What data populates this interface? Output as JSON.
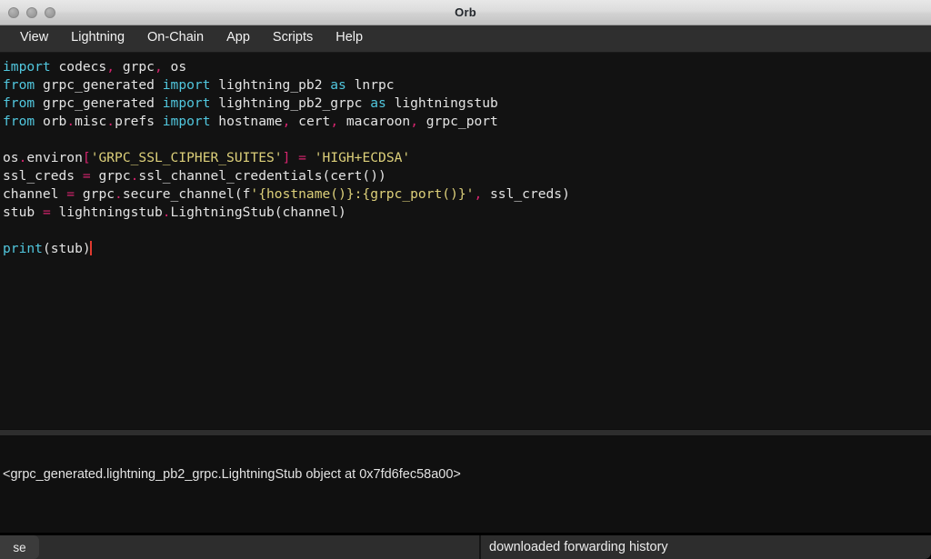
{
  "window": {
    "title": "Orb",
    "traffic_lights": [
      "close",
      "minimize",
      "zoom"
    ]
  },
  "menubar": {
    "items": [
      {
        "label": "View"
      },
      {
        "label": "Lightning"
      },
      {
        "label": "On-Chain"
      },
      {
        "label": "App"
      },
      {
        "label": "Scripts"
      },
      {
        "label": "Help"
      }
    ]
  },
  "editor": {
    "language": "python",
    "caret_visible": true,
    "code_text": "import codecs, grpc, os\nfrom grpc_generated import lightning_pb2 as lnrpc\nfrom grpc_generated import lightning_pb2_grpc as lightningstub\nfrom orb.misc.prefs import hostname, cert, macaroon, grpc_port\n\nos.environ['GRPC_SSL_CIPHER_SUITES'] = 'HIGH+ECDSA'\nssl_creds = grpc.ssl_channel_credentials(cert())\nchannel = grpc.secure_channel(f'{hostname()}:{grpc_port()}', ssl_creds)\nstub = lightningstub.LightningStub(channel)\n\nprint(stub)",
    "lines": [
      {
        "n": 1,
        "tokens": [
          {
            "t": "import",
            "c": "kw"
          },
          {
            "t": " codecs",
            "c": "id"
          },
          {
            "t": ",",
            "c": "punc"
          },
          {
            "t": " grpc",
            "c": "id"
          },
          {
            "t": ",",
            "c": "punc"
          },
          {
            "t": " os",
            "c": "id"
          }
        ]
      },
      {
        "n": 2,
        "tokens": [
          {
            "t": "from",
            "c": "kw"
          },
          {
            "t": " grpc_generated ",
            "c": "id"
          },
          {
            "t": "import",
            "c": "kw"
          },
          {
            "t": " lightning_pb2 ",
            "c": "id"
          },
          {
            "t": "as",
            "c": "kw"
          },
          {
            "t": " lnrpc",
            "c": "id"
          }
        ]
      },
      {
        "n": 3,
        "tokens": [
          {
            "t": "from",
            "c": "kw"
          },
          {
            "t": " grpc_generated ",
            "c": "id"
          },
          {
            "t": "import",
            "c": "kw"
          },
          {
            "t": " lightning_pb2_grpc ",
            "c": "id"
          },
          {
            "t": "as",
            "c": "kw"
          },
          {
            "t": " lightningstub",
            "c": "id"
          }
        ]
      },
      {
        "n": 4,
        "tokens": [
          {
            "t": "from",
            "c": "kw"
          },
          {
            "t": " orb",
            "c": "id"
          },
          {
            "t": ".",
            "c": "punc"
          },
          {
            "t": "misc",
            "c": "id"
          },
          {
            "t": ".",
            "c": "punc"
          },
          {
            "t": "prefs ",
            "c": "id"
          },
          {
            "t": "import",
            "c": "kw"
          },
          {
            "t": " hostname",
            "c": "id"
          },
          {
            "t": ",",
            "c": "punc"
          },
          {
            "t": " cert",
            "c": "id"
          },
          {
            "t": ",",
            "c": "punc"
          },
          {
            "t": " macaroon",
            "c": "id"
          },
          {
            "t": ",",
            "c": "punc"
          },
          {
            "t": " grpc_port",
            "c": "id"
          }
        ]
      },
      {
        "n": 5,
        "tokens": []
      },
      {
        "n": 6,
        "tokens": [
          {
            "t": "os",
            "c": "id"
          },
          {
            "t": ".",
            "c": "punc"
          },
          {
            "t": "environ",
            "c": "id"
          },
          {
            "t": "[",
            "c": "punc"
          },
          {
            "t": "'GRPC_SSL_CIPHER_SUITES'",
            "c": "str"
          },
          {
            "t": "]",
            "c": "punc"
          },
          {
            "t": " ",
            "c": "id"
          },
          {
            "t": "=",
            "c": "op"
          },
          {
            "t": " ",
            "c": "id"
          },
          {
            "t": "'HIGH+ECDSA'",
            "c": "str"
          }
        ]
      },
      {
        "n": 7,
        "tokens": [
          {
            "t": "ssl_creds ",
            "c": "id"
          },
          {
            "t": "=",
            "c": "op"
          },
          {
            "t": " grpc",
            "c": "id"
          },
          {
            "t": ".",
            "c": "punc"
          },
          {
            "t": "ssl_channel_credentials(cert())",
            "c": "id"
          }
        ]
      },
      {
        "n": 8,
        "tokens": [
          {
            "t": "channel ",
            "c": "id"
          },
          {
            "t": "=",
            "c": "op"
          },
          {
            "t": " grpc",
            "c": "id"
          },
          {
            "t": ".",
            "c": "punc"
          },
          {
            "t": "secure_channel(f",
            "c": "id"
          },
          {
            "t": "'{hostname()}:{grpc_port()}'",
            "c": "str"
          },
          {
            "t": ",",
            "c": "punc"
          },
          {
            "t": " ssl_creds)",
            "c": "id"
          }
        ]
      },
      {
        "n": 9,
        "tokens": [
          {
            "t": "stub ",
            "c": "id"
          },
          {
            "t": "=",
            "c": "op"
          },
          {
            "t": " lightningstub",
            "c": "id"
          },
          {
            "t": ".",
            "c": "punc"
          },
          {
            "t": "LightningStub(channel)",
            "c": "id"
          }
        ]
      },
      {
        "n": 10,
        "tokens": []
      },
      {
        "n": 11,
        "tokens": [
          {
            "t": "print",
            "c": "kw"
          },
          {
            "t": "(stub)",
            "c": "id"
          }
        ],
        "caret": true
      }
    ]
  },
  "output": {
    "text": "<grpc_generated.lightning_pb2_grpc.LightningStub object at 0x7fd6fec58a00>"
  },
  "statusbar": {
    "left_label": "se",
    "right_label": "downloaded forwarding history"
  },
  "colors": {
    "keyword": "#51c7de",
    "punctuation": "#d6246e",
    "string": "#ddd07a",
    "identifier": "#e4e4e4",
    "caret": "#e03a2f",
    "editor_bg": "#121212",
    "output_bg": "#101010",
    "menubar_bg": "#2f2f2f",
    "statusbar_bg": "#2d2d2d",
    "titlebar_text": "#22262b"
  }
}
